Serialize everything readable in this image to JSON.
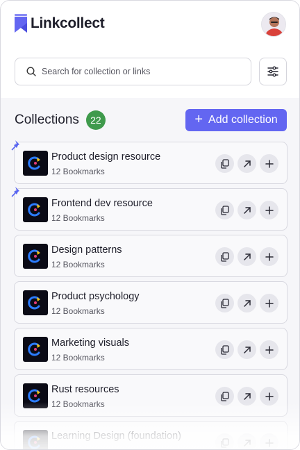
{
  "app": {
    "name": "Linkcollect"
  },
  "search": {
    "placeholder": "Search for collection or links"
  },
  "collections": {
    "title": "Collections",
    "count": "22",
    "add_label": "Add collection",
    "items": [
      {
        "title": "Product design resource",
        "subtitle": "12 Bookmarks",
        "pinned": true
      },
      {
        "title": "Frontend dev resource",
        "subtitle": "12 Bookmarks",
        "pinned": true
      },
      {
        "title": "Design patterns",
        "subtitle": "12 Bookmarks",
        "pinned": false
      },
      {
        "title": "Product psychology",
        "subtitle": "12 Bookmarks",
        "pinned": false
      },
      {
        "title": "Marketing visuals",
        "subtitle": "12 Bookmarks",
        "pinned": false
      },
      {
        "title": "Rust resources",
        "subtitle": "12 Bookmarks",
        "pinned": false
      },
      {
        "title": "Learning Design (foundation)",
        "subtitle": "",
        "pinned": false
      }
    ]
  },
  "colors": {
    "accent": "#6366f1",
    "badge": "#3f9a4c",
    "pin": "#5865f2"
  },
  "icons": [
    "search-icon",
    "filter-icon",
    "pin-icon",
    "copy-icon",
    "open-arrow-icon",
    "plus-icon"
  ]
}
